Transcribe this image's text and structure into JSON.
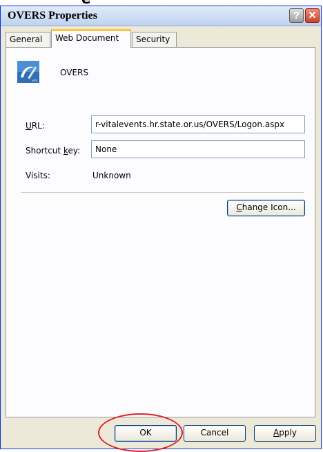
{
  "window": {
    "title": "OVERS Properties",
    "help_glyph": "?",
    "close_glyph": "✕"
  },
  "tabs": [
    {
      "label": "General"
    },
    {
      "label": "Web Document",
      "selected": true
    },
    {
      "label": "Security"
    }
  ],
  "item": {
    "name": "OVERS",
    "icon": "overs-app-icon"
  },
  "fields": {
    "url_label": "URL:",
    "url_value": "r-vitalevents.hr.state.or.us/OVERS/Logon.aspx",
    "shortcut_label": "Shortcut key:",
    "shortcut_value": "None",
    "visits_label": "Visits:",
    "visits_value": "Unknown"
  },
  "buttons": {
    "change_icon": "Change Icon...",
    "ok": "OK",
    "cancel": "Cancel",
    "apply": "Apply"
  },
  "annotation": {
    "color": "#e0202a",
    "target": "OK"
  }
}
